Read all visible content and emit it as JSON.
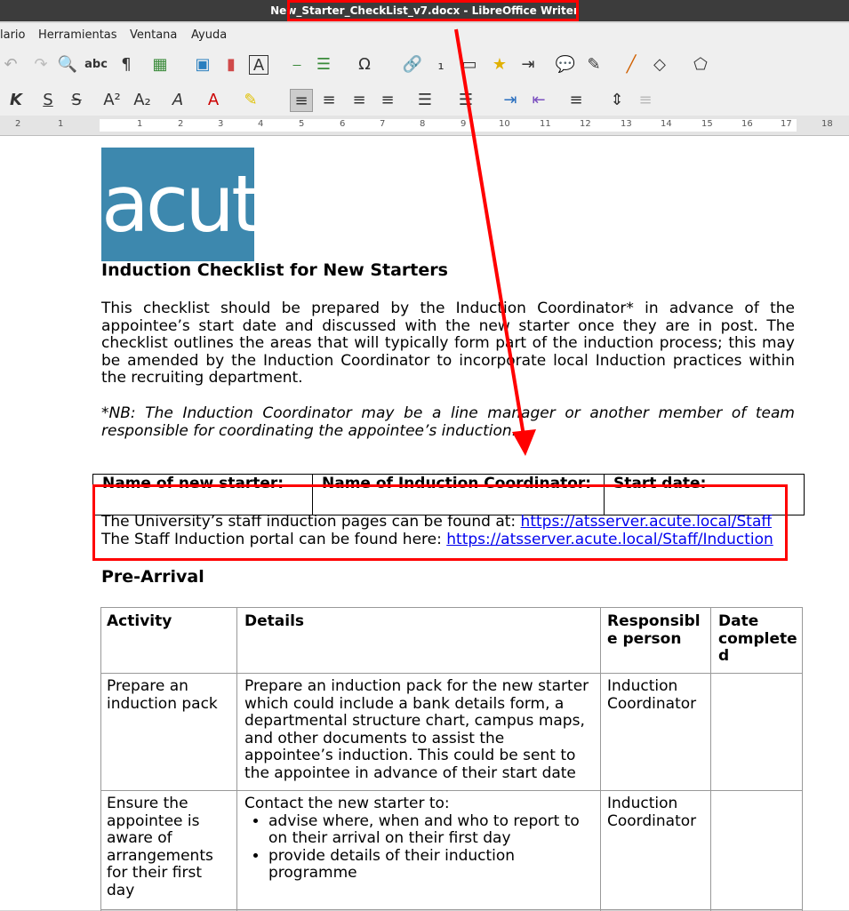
{
  "window": {
    "title": "New_Starter_CheckList_v7.docx - LibreOffice Writer"
  },
  "menu": [
    "lario",
    "Herramientas",
    "Ventana",
    "Ayuda"
  ],
  "ruler": {
    "labels": [
      "2",
      "1",
      "1",
      "2",
      "3",
      "4",
      "5",
      "6",
      "7",
      "8",
      "9",
      "10",
      "11",
      "12",
      "13",
      "14",
      "15",
      "16",
      "17",
      "18"
    ]
  },
  "document": {
    "logo_text": "acute",
    "title": "Induction Checklist for New Starters",
    "intro": "This checklist should be prepared by the Induction Coordinator* in advance of the appointee’s start date and discussed with the new starter once they are in post. The checklist outlines the areas that will typically form part of the induction process; this may be amended by the Induction Coordinator to incorporate local Induction practices within the recruiting department.",
    "nb": "*NB: The Induction Coordinator may be a line manager or another member of team responsible for coordinating the appointee’s induction.",
    "name_table": [
      "Name of new starter:",
      "Name of Induction Coordinator:",
      "Start date:"
    ],
    "links": [
      {
        "prefix": "The University’s staff induction pages can be found at: ",
        "url": "https://atsserver.acute.local/Staff"
      },
      {
        "prefix": "The Staff Induction portal can be found here: ",
        "url": "https://atsserver.acute.local/Staff/Induction"
      }
    ],
    "section_title": "Pre-Arrival",
    "table": {
      "headers": [
        "Activity",
        "Details",
        "Responsibl e person",
        "Date complete d"
      ],
      "rows": [
        {
          "activity": "Prepare an induction pack",
          "details": "Prepare an induction pack for the new starter which could include a bank details form, a departmental structure chart, campus maps, and other documents to assist the appointee’s induction. This could be sent to the appointee in advance of their start date",
          "responsible": "Induction Coordinator"
        },
        {
          "activity": "Ensure the appointee is aware of arrangements for their first day",
          "details_intro": "Contact the new starter to:",
          "bullets": [
            "advise where, when and who to report to on their arrival on their first day",
            "provide details of their induction programme"
          ],
          "responsible": "Induction Coordinator"
        }
      ]
    }
  }
}
